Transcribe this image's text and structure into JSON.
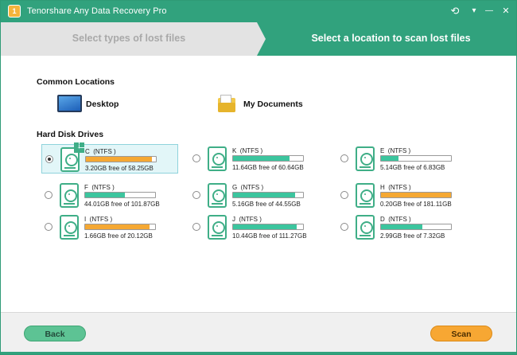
{
  "window": {
    "title": "Tenorshare Any Data Recovery Pro",
    "logo_text": "1"
  },
  "title_controls": {
    "history": "⟲",
    "menu": "▾",
    "minimize": "—",
    "close": "✕"
  },
  "steps": {
    "step1": "Select types of lost files",
    "step2": "Select a location to scan lost files"
  },
  "common_locations": {
    "heading": "Common Locations",
    "desktop": "Desktop",
    "documents": "My Documents"
  },
  "hard_disk": {
    "heading": "Hard Disk Drives",
    "drives": [
      {
        "name": "C  (NTFS )",
        "free": "3.20GB free of 58.25GB",
        "used_fraction": 0.945,
        "color": "#f5a833",
        "selected": true,
        "system": true
      },
      {
        "name": "K  (NTFS )",
        "free": "11.64GB free of 60.64GB",
        "used_fraction": 0.81,
        "color": "#3cc59e",
        "selected": false,
        "system": false
      },
      {
        "name": "E  (NTFS )",
        "free": "5.14GB free of 6.83GB",
        "used_fraction": 0.25,
        "color": "#3cc59e",
        "selected": false,
        "system": false
      },
      {
        "name": "F  (NTFS )",
        "free": "44.01GB free of 101.87GB",
        "used_fraction": 0.57,
        "color": "#3cc59e",
        "selected": false,
        "system": false
      },
      {
        "name": "G  (NTFS )",
        "free": "5.16GB free of 44.55GB",
        "used_fraction": 0.885,
        "color": "#3cc59e",
        "selected": false,
        "system": false
      },
      {
        "name": "H  (NTFS )",
        "free": "0.20GB free of 181.11GB",
        "used_fraction": 0.999,
        "color": "#f5a833",
        "selected": false,
        "system": false
      },
      {
        "name": "I  (NTFS )",
        "free": "1.66GB free of 20.12GB",
        "used_fraction": 0.918,
        "color": "#f5a833",
        "selected": false,
        "system": false
      },
      {
        "name": "J  (NTFS )",
        "free": "10.44GB free of 111.27GB",
        "used_fraction": 0.906,
        "color": "#3cc59e",
        "selected": false,
        "system": false
      },
      {
        "name": "D  (NTFS )",
        "free": "2.99GB free of 7.32GB",
        "used_fraction": 0.59,
        "color": "#3cc59e",
        "selected": false,
        "system": false
      }
    ]
  },
  "footer": {
    "back": "Back",
    "scan": "Scan"
  }
}
